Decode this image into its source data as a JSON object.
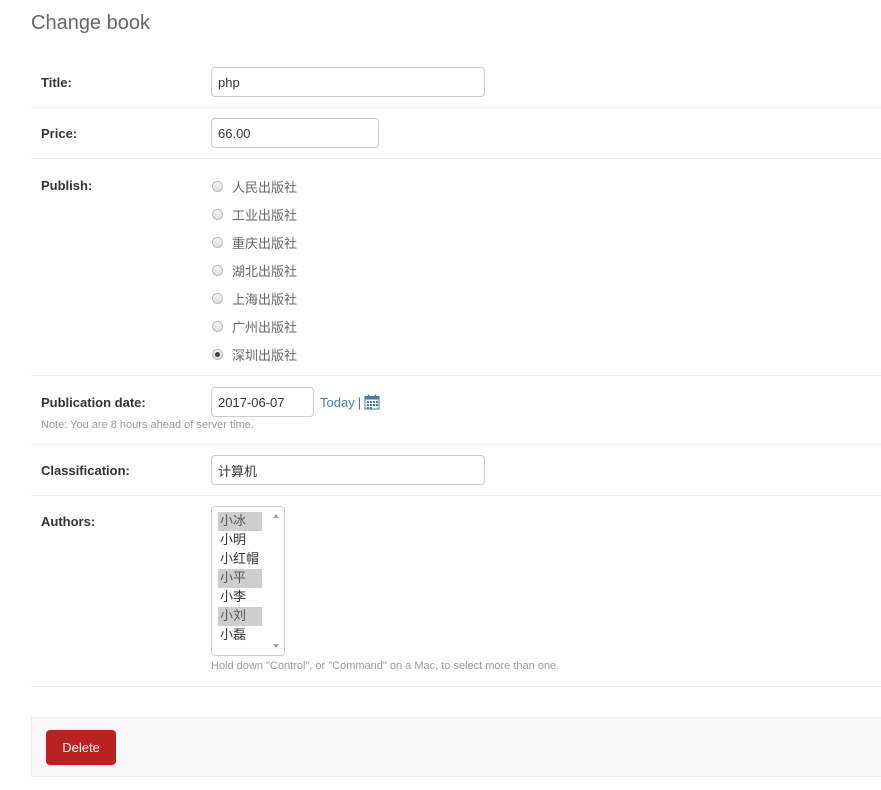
{
  "page": {
    "title": "Change book"
  },
  "fields": {
    "title": {
      "label": "Title:",
      "value": "php"
    },
    "price": {
      "label": "Price:",
      "value": "66.00"
    },
    "publish": {
      "label": "Publish:",
      "options": [
        "人民出版社",
        "工业出版社",
        "重庆出版社",
        "湖北出版社",
        "上海出版社",
        "广州出版社",
        "深圳出版社"
      ],
      "selected": "深圳出版社"
    },
    "publication_date": {
      "label": "Publication date:",
      "value": "2017-06-07",
      "today_link": "Today",
      "separator": "|",
      "calendar_icon": "calendar-icon",
      "help": "Note: You are 8 hours ahead of server time."
    },
    "classification": {
      "label": "Classification:",
      "value": "计算机"
    },
    "authors": {
      "label": "Authors:",
      "options": [
        "小冰",
        "小明",
        "小红帽",
        "小平",
        "小李",
        "小刘",
        "小磊"
      ],
      "selected": [
        "小冰",
        "小平",
        "小刘"
      ],
      "help": "Hold down \"Control\", or \"Command\" on a Mac, to select more than one."
    }
  },
  "actions": {
    "delete_label": "Delete"
  },
  "colors": {
    "delete": "#ba2121",
    "link": "#447e9b",
    "selected_option": "#cecece"
  }
}
